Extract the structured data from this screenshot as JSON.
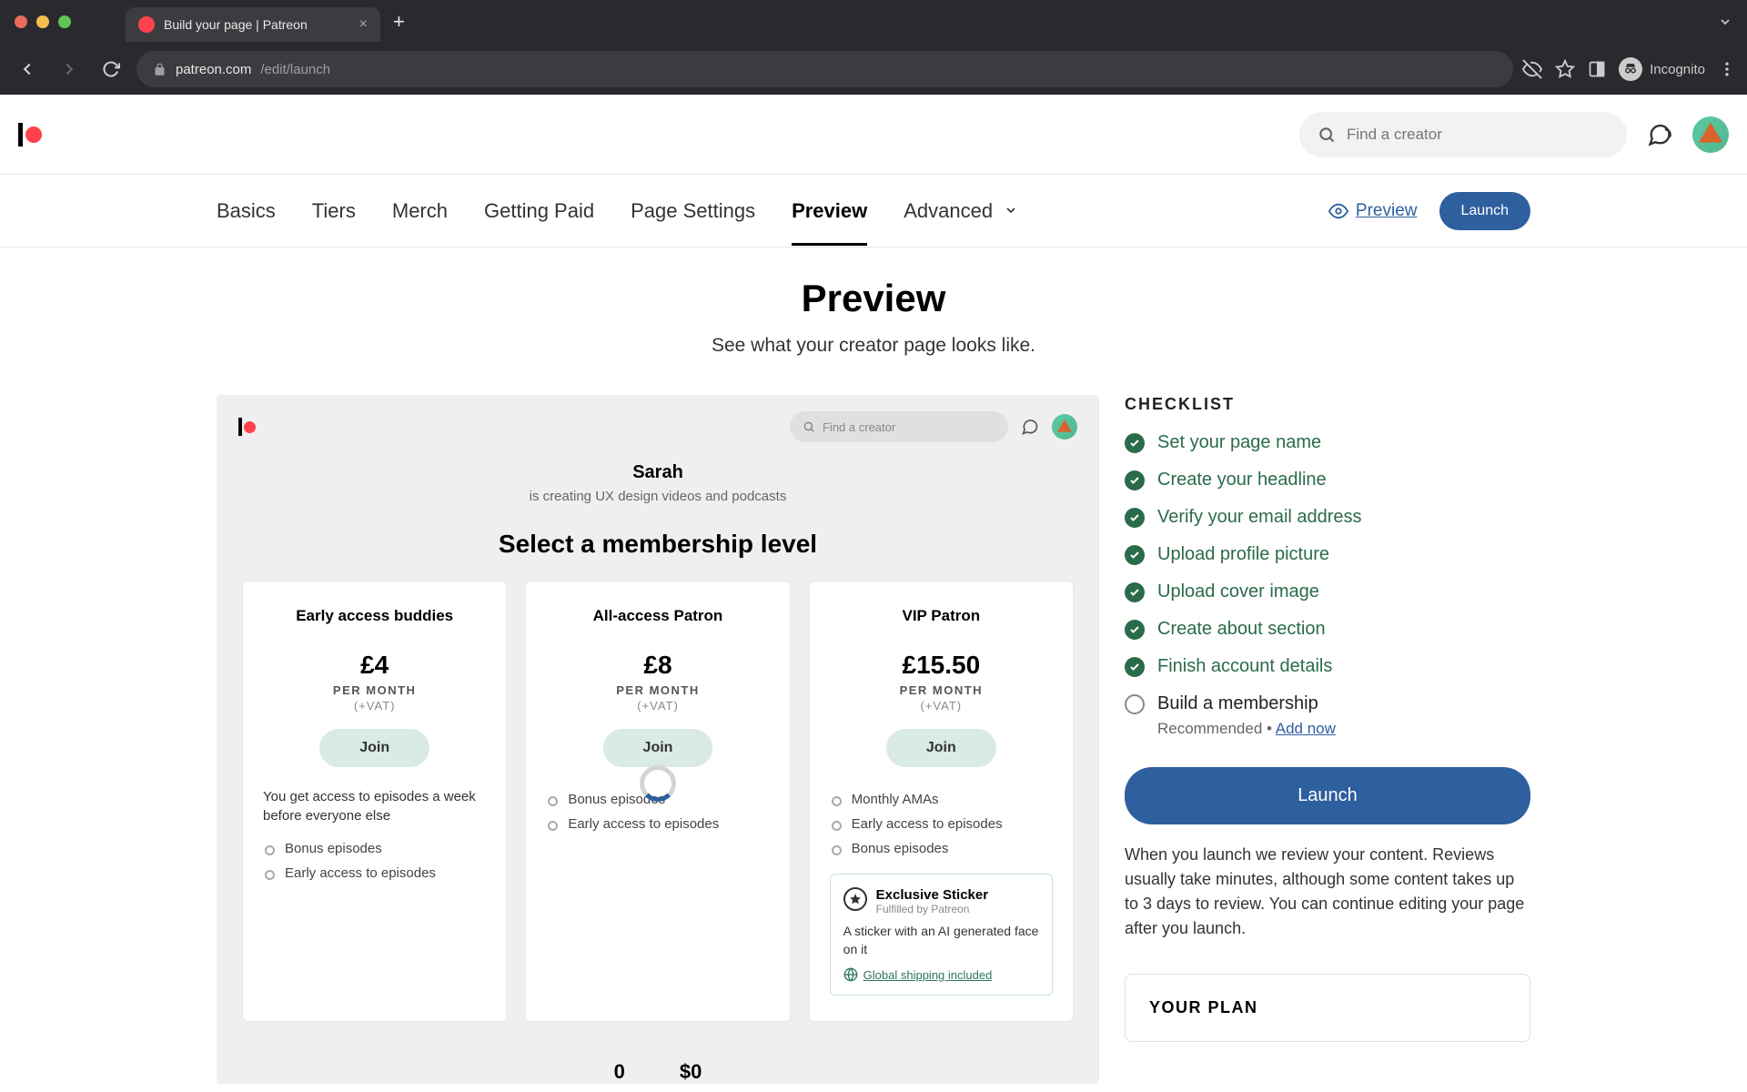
{
  "browser": {
    "tab_title": "Build your page | Patreon",
    "url_host": "patreon.com",
    "url_path": "/edit/launch",
    "incognito": "Incognito"
  },
  "header": {
    "search_placeholder": "Find a creator"
  },
  "nav": {
    "basics": "Basics",
    "tiers": "Tiers",
    "merch": "Merch",
    "getting_paid": "Getting Paid",
    "page_settings": "Page Settings",
    "preview": "Preview",
    "advanced": "Advanced",
    "preview_link": "Preview",
    "launch_btn": "Launch"
  },
  "page": {
    "title": "Preview",
    "subtitle": "See what your creator page looks like."
  },
  "preview": {
    "search_placeholder": "Find a creator",
    "creator_name": "Sarah",
    "creator_sub": "is creating UX design videos and podcasts",
    "select_title": "Select a membership level",
    "tiers": [
      {
        "name": "Early access buddies",
        "price": "£4",
        "period": "PER MONTH",
        "vat": "(+VAT)",
        "join": "Join",
        "desc": "You get access to episodes a week before everyone else",
        "benefits": [
          "Bonus episodes",
          "Early access to episodes"
        ]
      },
      {
        "name": "All-access Patron",
        "price": "£8",
        "period": "PER MONTH",
        "vat": "(+VAT)",
        "join": "Join",
        "benefits": [
          "Bonus episodes",
          "Early access to episodes"
        ]
      },
      {
        "name": "VIP Patron",
        "price": "£15.50",
        "period": "PER MONTH",
        "vat": "(+VAT)",
        "join": "Join",
        "benefits": [
          "Monthly AMAs",
          "Early access to episodes",
          "Bonus episodes"
        ],
        "merch": {
          "title": "Exclusive Sticker",
          "fulfilled": "Fulfilled by Patreon",
          "desc": "A sticker with an AI generated face on it",
          "shipping": "Global shipping included"
        }
      }
    ],
    "stats": {
      "patrons": "0",
      "income": "$0"
    }
  },
  "checklist": {
    "title": "CHECKLIST",
    "items": [
      "Set your page name",
      "Create your headline",
      "Verify your email address",
      "Upload profile picture",
      "Upload cover image",
      "Create about section",
      "Finish account details"
    ],
    "pending": "Build a membership",
    "pending_sub_pre": "Recommended • ",
    "pending_sub_link": "Add now",
    "launch_btn": "Launch",
    "launch_note": "When you launch we review your content. Reviews usually take minutes, although some content takes up to 3 days to review. You can continue editing your page after you launch.",
    "your_plan": "YOUR PLAN"
  }
}
